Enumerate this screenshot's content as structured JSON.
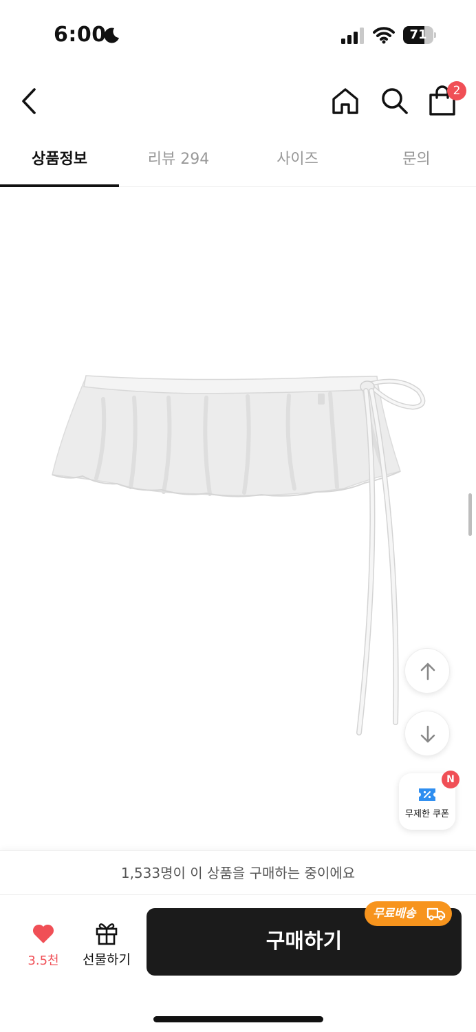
{
  "status_bar": {
    "time": "6:00",
    "battery": "71",
    "battery_level": 0.71
  },
  "nav": {
    "cart_count": "2"
  },
  "tabs": [
    {
      "label": "상품정보",
      "active": true
    },
    {
      "label": "리뷰 294",
      "active": false
    },
    {
      "label": "사이즈",
      "active": false
    },
    {
      "label": "문의",
      "active": false
    }
  ],
  "coupon": {
    "label": "무제한 쿠폰",
    "badge": "N"
  },
  "notice": "1,533명이 이 상품을 구매하는 중이에요",
  "actions": {
    "like_count": "3.5천",
    "gift_label": "선물하기",
    "buy_label": "구매하기",
    "shipping_badge": "무료배송"
  },
  "colors": {
    "accent_red": "#f04f56",
    "badge_orange": "#f7941d",
    "button_dark": "#1b1b1b",
    "coupon_blue": "#2f8ef0"
  }
}
